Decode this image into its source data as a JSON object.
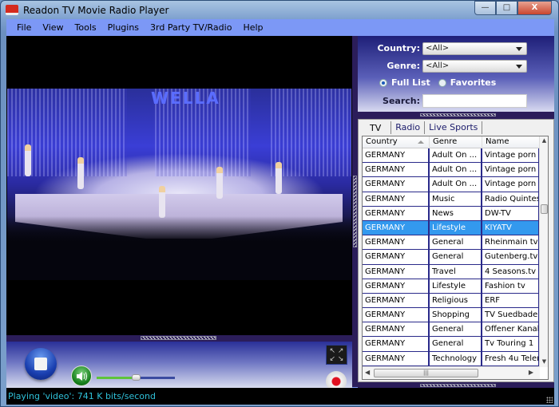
{
  "window": {
    "title": "Readon TV Movie Radio Player",
    "controls": {
      "minimize": "—",
      "maximize": "□",
      "close": "X"
    }
  },
  "menu": [
    "File",
    "View",
    "Tools",
    "Plugins",
    "3rd Party TV/Radio",
    "Help"
  ],
  "video": {
    "overlay_logo": "WELLA"
  },
  "player": {
    "volume_percent": 50,
    "icons": {
      "stop": "stop-icon",
      "volume": "speaker-icon",
      "fullscreen": "fullscreen-icon",
      "record": "record-icon"
    }
  },
  "status": {
    "text": "Playing 'video': 741 K bits/second"
  },
  "filters": {
    "country_label": "Country:",
    "country_value": "<All>",
    "genre_label": "Genre:",
    "genre_value": "<All>",
    "full_list_label": "Full List",
    "favorites_label": "Favorites",
    "selected_mode": "Full List",
    "search_label": "Search:",
    "search_value": ""
  },
  "tabs": [
    "TV",
    "Radio",
    "Live Sports"
  ],
  "active_tab": "TV",
  "table": {
    "columns": [
      "Country",
      "Genre",
      "Name"
    ],
    "sorted_by": "Country",
    "rows": [
      [
        "GERMANY",
        "Adult On ...",
        "Vintage porn -"
      ],
      [
        "GERMANY",
        "Adult On ...",
        "Vintage porn -"
      ],
      [
        "GERMANY",
        "Adult On ...",
        "Vintage porn -"
      ],
      [
        "GERMANY",
        "Music",
        "Radio Quintess"
      ],
      [
        "GERMANY",
        "News",
        "DW-TV"
      ],
      [
        "GERMANY",
        "Lifestyle",
        "KIYATV"
      ],
      [
        "GERMANY",
        "General",
        "Rheinmain tv"
      ],
      [
        "GERMANY",
        "General",
        "Gutenberg.tv"
      ],
      [
        "GERMANY",
        "Travel",
        "4 Seasons.tv"
      ],
      [
        "GERMANY",
        "Lifestyle",
        "Fashion tv"
      ],
      [
        "GERMANY",
        "Religious",
        "ERF"
      ],
      [
        "GERMANY",
        "Shopping",
        "TV Suedbaden"
      ],
      [
        "GERMANY",
        "General",
        "Offener Kanal"
      ],
      [
        "GERMANY",
        "General",
        "Tv Touring 1"
      ],
      [
        "GERMANY",
        "Technology",
        "Fresh 4u Teler"
      ]
    ],
    "selected_row": 5
  },
  "colors": {
    "menubar": "#7c98f6",
    "status_text": "#2fc0d8",
    "selection": "#3399ee",
    "panel_dark": "#2b1d5a"
  }
}
